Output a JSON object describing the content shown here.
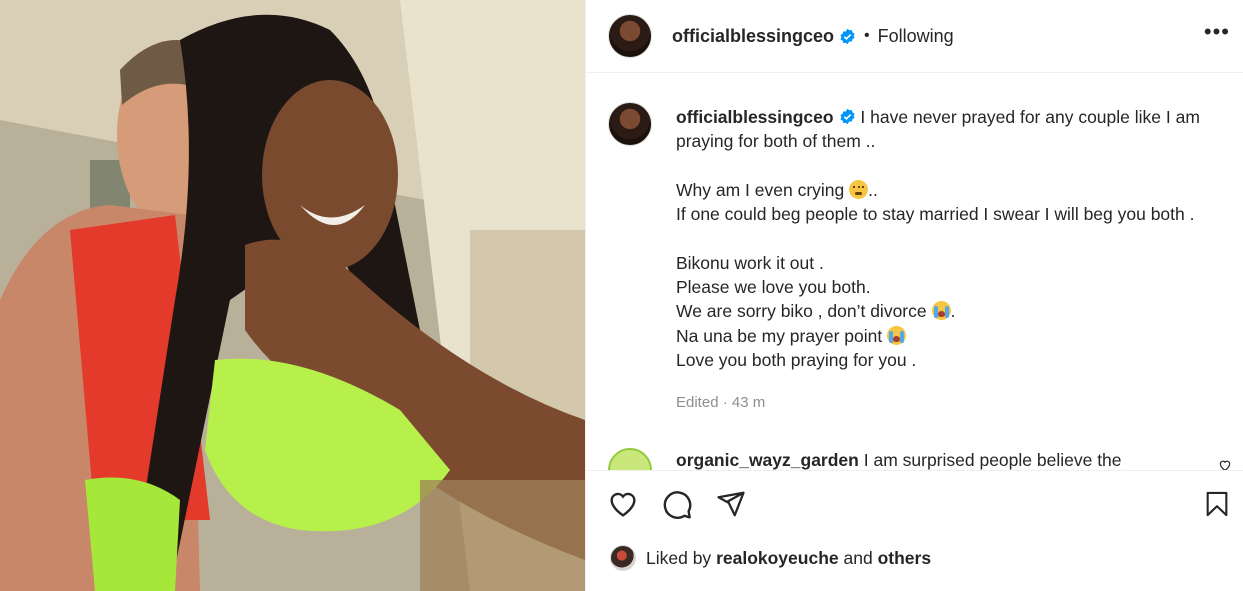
{
  "post": {
    "photo_alt": "Photo of a couple posing together in sunlight"
  },
  "header": {
    "username": "officialblessingceo",
    "separator": "•",
    "follow_status": "Following",
    "more_label": "•••"
  },
  "caption": {
    "username": "officialblessingceo",
    "line1": "I have never prayed for any couple like I am praying for both of them ..",
    "line2_text": "Why am I even crying",
    "line2_after": "..",
    "line3": "If one could beg people to stay married I swear I will beg you both .",
    "line4": "Bikonu work it out .",
    "line5": "Please we love you both.",
    "line6_text": "We are sorry biko , don’t divorce",
    "line6_after": ".",
    "line7_text": "Na una be my prayer point",
    "line8": "Love you both praying for you .",
    "edited": "Edited · 43 m"
  },
  "comment": {
    "username": "organic_wayz_garden",
    "text": "I am surprised people believe the"
  },
  "likes": {
    "prefix": "Liked by",
    "user": "realokoyeuche",
    "joiner": "and",
    "others": "others"
  },
  "colors": {
    "verified_blue": "#0095f6",
    "text": "#262626",
    "muted": "#8e8e8e",
    "divider": "#efefef"
  },
  "icons": {
    "like": "heart-outline-icon",
    "comment": "speech-bubble-icon",
    "share": "paper-plane-icon",
    "save": "bookmark-icon",
    "verified": "verified-badge-icon"
  }
}
